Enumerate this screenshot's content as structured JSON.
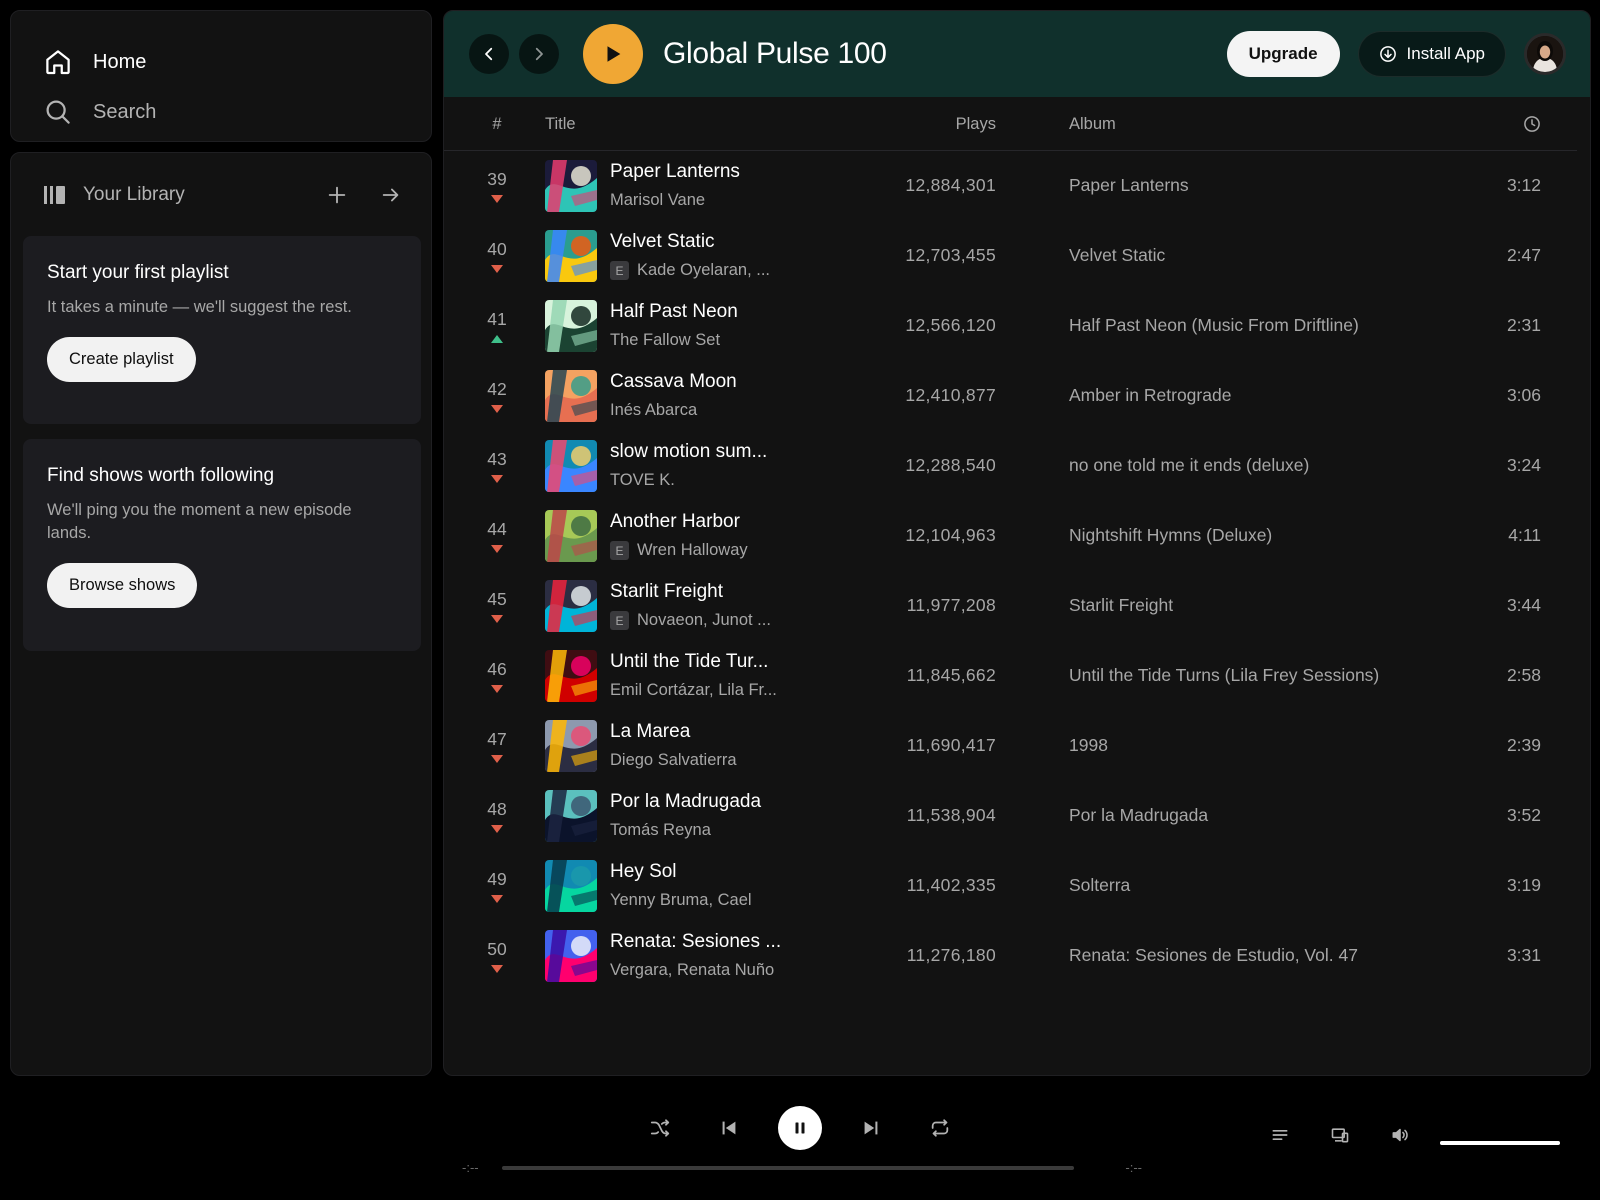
{
  "nav": {
    "home_label": "Home",
    "search_label": "Search"
  },
  "library": {
    "title": "Your Library",
    "promos": [
      {
        "heading": "Start your first playlist",
        "body": "It takes a minute — we'll suggest the rest.",
        "button": "Create playlist"
      },
      {
        "heading": "Find shows worth following",
        "body": "We'll ping you the moment a new episode lands.",
        "button": "Browse shows"
      }
    ]
  },
  "header": {
    "title": "Global Pulse 100",
    "upgrade_label": "Upgrade",
    "install_label": "Install App",
    "accent": "#f0a734",
    "header_bg": "#10302c"
  },
  "table": {
    "columns": {
      "num": "#",
      "title": "Title",
      "plays": "Plays",
      "album": "Album",
      "duration_icon": "clock-icon"
    },
    "rows": [
      {
        "rank": "39",
        "trend": "down",
        "title": "Paper Lanterns",
        "artist": "Marisol Vane",
        "explicit": false,
        "plays": "12,884,301",
        "album": "Paper Lanterns",
        "duration": "3:12"
      },
      {
        "rank": "40",
        "trend": "down",
        "title": "Velvet Static",
        "artist": "Kade Oyelaran, ...",
        "explicit": true,
        "plays": "12,703,455",
        "album": "Velvet Static",
        "duration": "2:47"
      },
      {
        "rank": "41",
        "trend": "up",
        "title": "Half Past Neon",
        "artist": "The Fallow Set",
        "explicit": false,
        "plays": "12,566,120",
        "album": "Half Past Neon (Music From Driftline)",
        "duration": "2:31"
      },
      {
        "rank": "42",
        "trend": "down",
        "title": "Cassava Moon",
        "artist": "Inés Abarca",
        "explicit": false,
        "plays": "12,410,877",
        "album": "Amber in Retrograde",
        "duration": "3:06"
      },
      {
        "rank": "43",
        "trend": "down",
        "title": "slow motion sum...",
        "artist": "TOVE K.",
        "explicit": false,
        "plays": "12,288,540",
        "album": "no one told me it ends (deluxe)",
        "duration": "3:24"
      },
      {
        "rank": "44",
        "trend": "down",
        "title": "Another Harbor",
        "artist": "Wren Halloway",
        "explicit": true,
        "plays": "12,104,963",
        "album": "Nightshift Hymns (Deluxe)",
        "duration": "4:11"
      },
      {
        "rank": "45",
        "trend": "down",
        "title": "Starlit Freight",
        "artist": "Novaeon, Junot ...",
        "explicit": true,
        "plays": "11,977,208",
        "album": "Starlit Freight",
        "duration": "3:44"
      },
      {
        "rank": "46",
        "trend": "down",
        "title": "Until the Tide Tur...",
        "artist": "Emil Cortázar, Lila Fr...",
        "explicit": false,
        "plays": "11,845,662",
        "album": "Until the Tide Turns (Lila Frey Sessions)",
        "duration": "2:58"
      },
      {
        "rank": "47",
        "trend": "down",
        "title": "La Marea",
        "artist": "Diego Salvatierra",
        "explicit": false,
        "plays": "11,690,417",
        "album": "1998",
        "duration": "2:39"
      },
      {
        "rank": "48",
        "trend": "down",
        "title": "Por la Madrugada",
        "artist": "Tomás Reyna",
        "explicit": false,
        "plays": "11,538,904",
        "album": "Por la Madrugada",
        "duration": "3:52"
      },
      {
        "rank": "49",
        "trend": "down",
        "title": "Hey Sol",
        "artist": "Yenny Bruma, Cael",
        "explicit": false,
        "plays": "11,402,335",
        "album": "Solterra",
        "duration": "3:19"
      },
      {
        "rank": "50",
        "trend": "down",
        "title": "Renata: Sesiones ...",
        "artist": "Vergara, Renata Nuño",
        "explicit": false,
        "plays": "11,276,180",
        "album": "Renata: Sesiones de Estudio, Vol. 47",
        "duration": "3:31"
      }
    ],
    "explicit_mark": "E",
    "trend_colors": {
      "down": "#e0604a",
      "up": "#3fbf8a"
    }
  },
  "player": {
    "time_elapsed": "-:--",
    "time_total": "-:--",
    "progress": 0,
    "volume": 1.0
  }
}
